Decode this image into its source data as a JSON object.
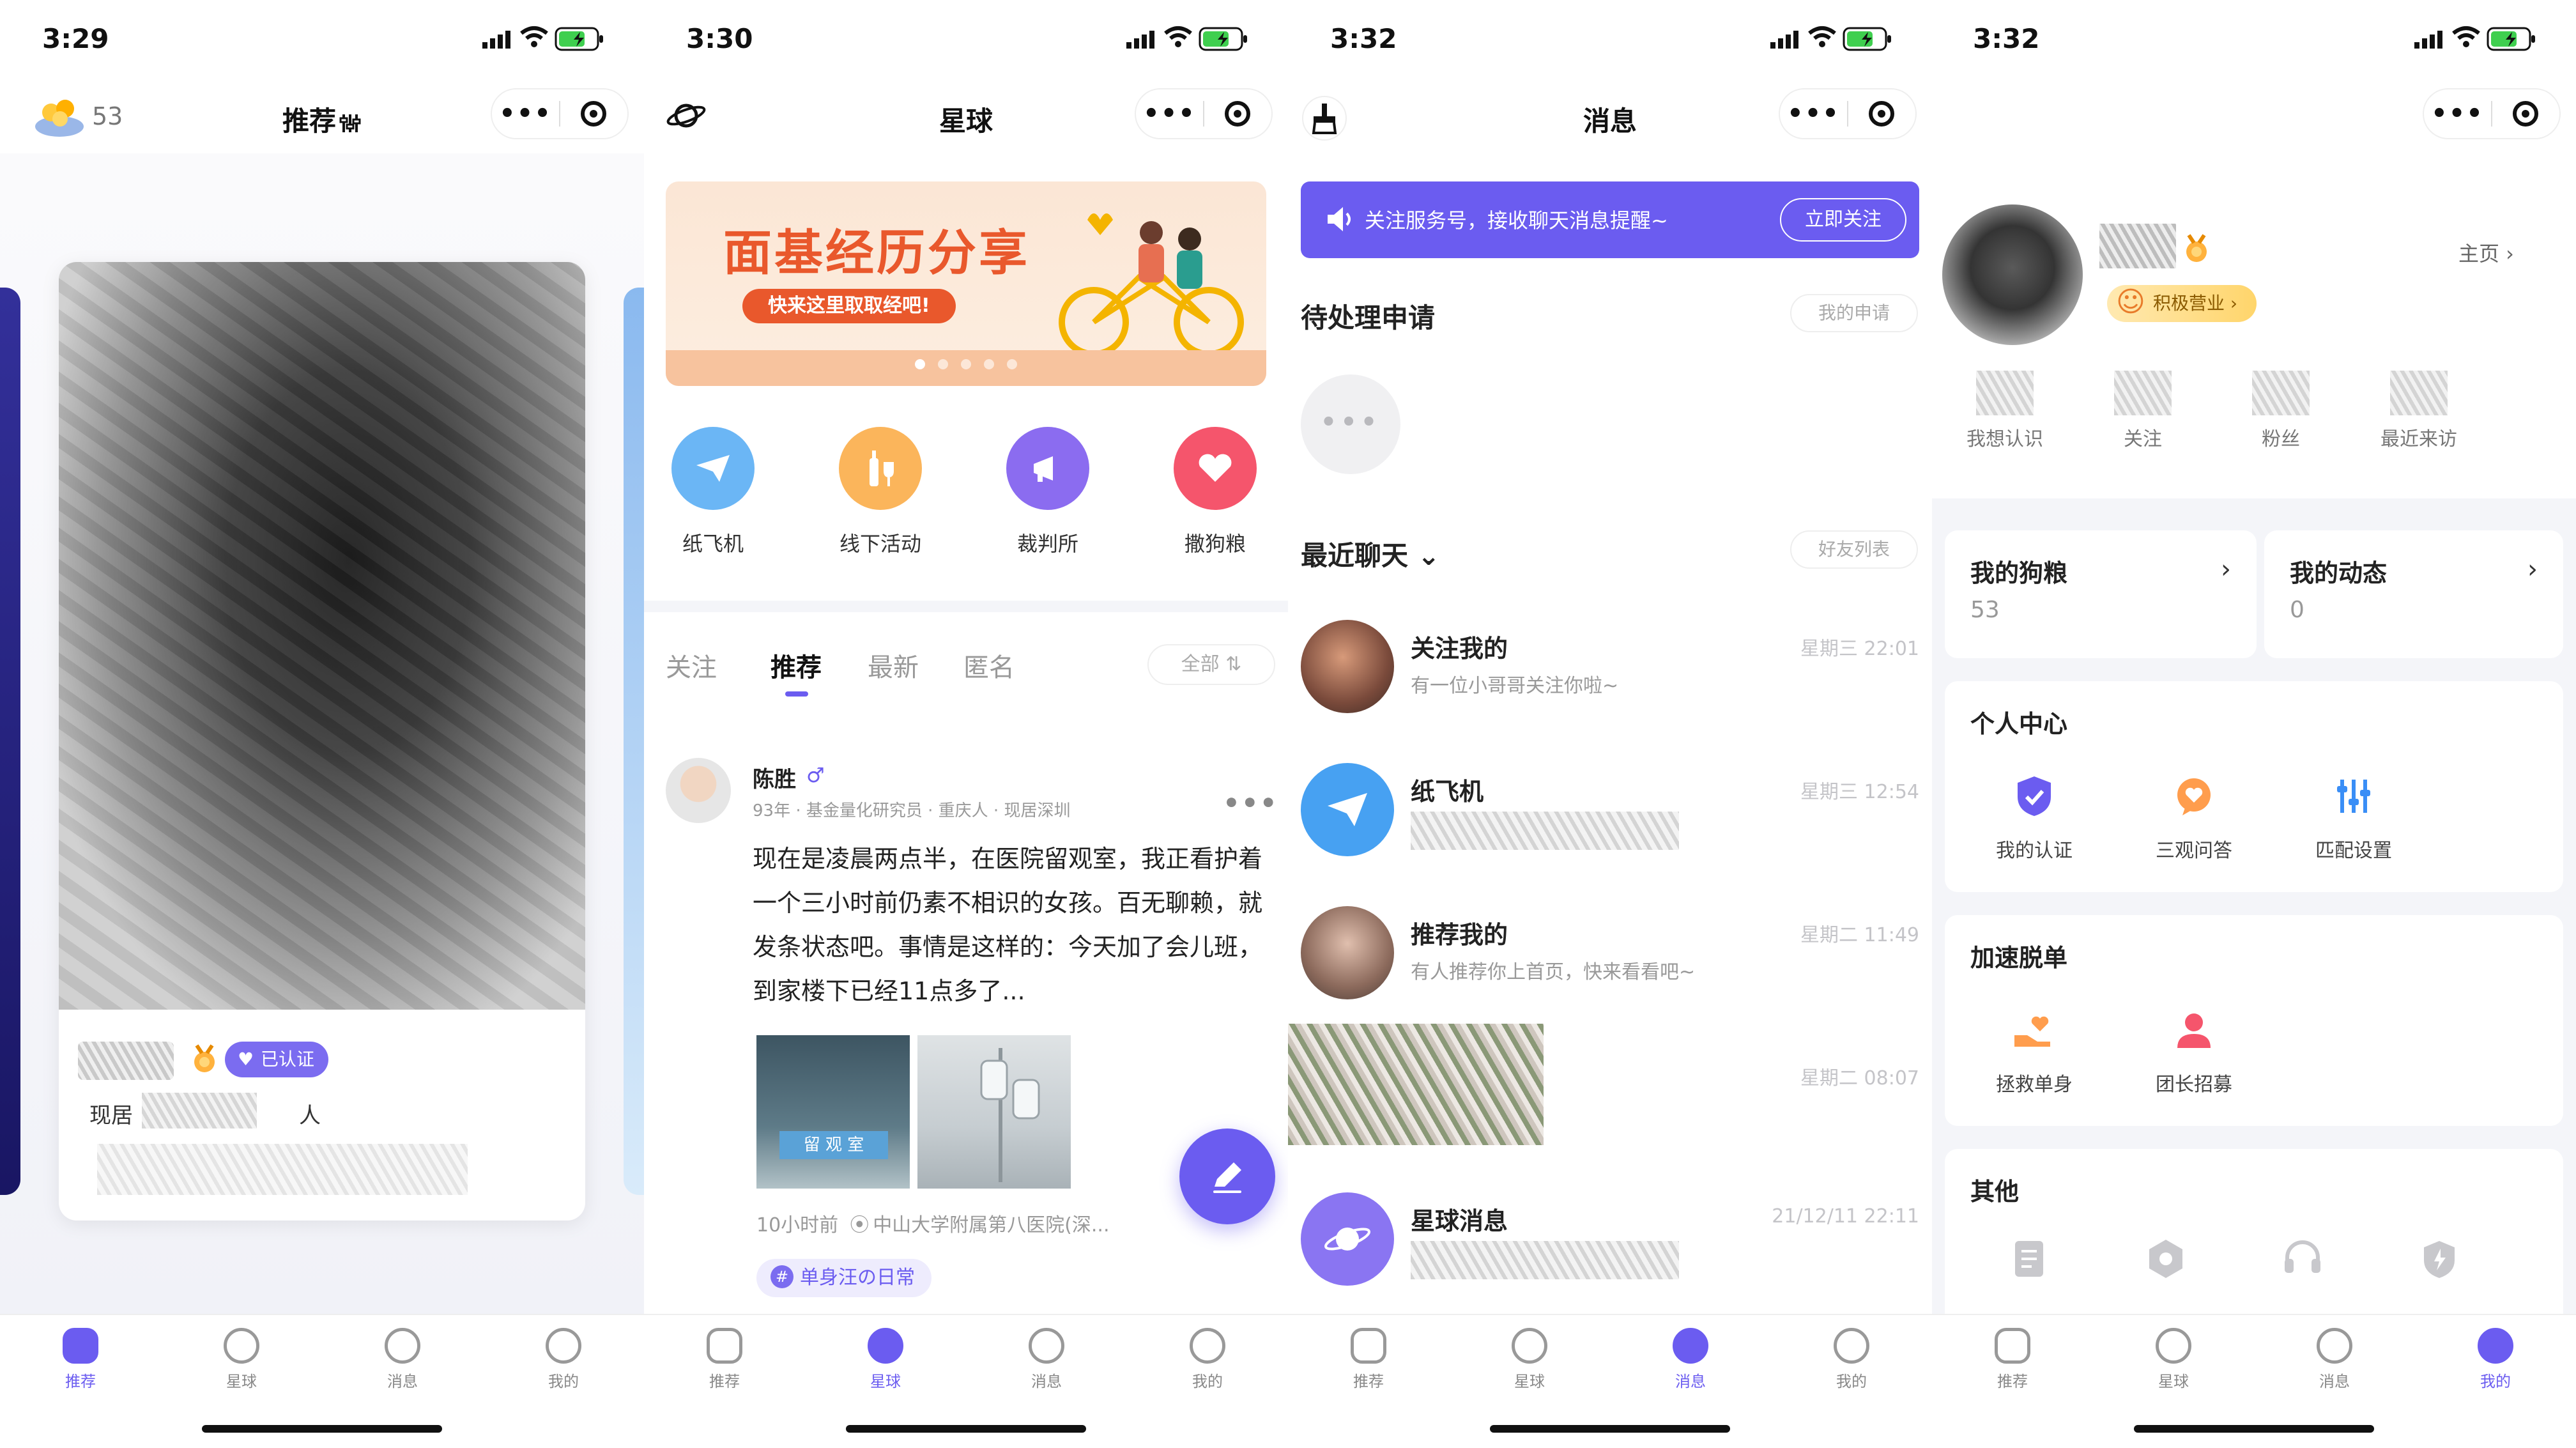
{
  "colors": {
    "accent": "#6b5cf0",
    "orange": "#e9582c",
    "bg": "#f4f5f9"
  },
  "screens": {
    "recommend": {
      "status_time": "3:29",
      "coin_count": "53",
      "title": "推荐",
      "card": {
        "verified": "已认证",
        "location": "现居",
        "location_suffix": "人"
      },
      "tabs": [
        "推荐",
        "星球",
        "消息",
        "我的"
      ]
    },
    "planet": {
      "status_time": "3:30",
      "title": "星球",
      "banner": {
        "title": "面基经历分享",
        "subtitle": "快来这里取取经吧!"
      },
      "quick": [
        "纸飞机",
        "线下活动",
        "裁判所",
        "撒狗粮"
      ],
      "feed_tabs": [
        "关注",
        "推荐",
        "最新",
        "匿名"
      ],
      "filter": "全部 ⇅",
      "post": {
        "author": "陈胜",
        "gender": "♂",
        "meta": "93年 · 基金量化研究员 · 重庆人 · 现居深圳",
        "body": "现在是凌晨两点半，在医院留观室，我正看护着一个三小时前仍素不相识的女孩。百无聊赖，就发条状态吧。事情是这样的：今天加了会儿班，到家楼下已经11点多了...",
        "image1_text": "留 观 室",
        "time": "10小时前",
        "place": "中山大学附属第八医院(深...",
        "topic": "单身汪の日常"
      },
      "tabs": [
        "推荐",
        "星球",
        "消息",
        "我的"
      ]
    },
    "messages": {
      "status_time": "3:32",
      "title": "消息",
      "notice": {
        "text": "关注服务号，接收聊天消息提醒~",
        "button": "立即关注"
      },
      "pending": {
        "title": "待处理申请",
        "button": "我的申请"
      },
      "recent": {
        "title": "最近聊天 ⌄",
        "button": "好友列表"
      },
      "chats": [
        {
          "name": "关注我的",
          "preview": "有一位小哥哥关注你啦~",
          "time": "星期三 22:01"
        },
        {
          "name": "纸飞机",
          "preview": "",
          "time": "星期三 12:54"
        },
        {
          "name": "推荐我的",
          "preview": "有人推荐你上首页，快来看看吧~",
          "time": "星期二 11:49"
        },
        {
          "name": "",
          "preview": "",
          "time": "星期二 08:07"
        },
        {
          "name": "星球消息",
          "preview": "",
          "time": "21/12/11 22:11"
        }
      ],
      "tabs": [
        "推荐",
        "星球",
        "消息",
        "我的"
      ]
    },
    "mine": {
      "status_time": "3:32",
      "badge": "积极营业 ›",
      "home": "主页 ›",
      "stats": [
        "我想认识",
        "关注",
        "粉丝",
        "最近来访"
      ],
      "cards": [
        {
          "title": "我的狗粮",
          "value": "53"
        },
        {
          "title": "我的动态",
          "value": "0"
        }
      ],
      "personal": {
        "title": "个人中心",
        "items": [
          "我的认证",
          "三观问答",
          "匹配设置"
        ]
      },
      "speed": {
        "title": "加速脱单",
        "items": [
          "拯救单身",
          "团长招募"
        ]
      },
      "other": {
        "title": "其他"
      },
      "tabs": [
        "推荐",
        "星球",
        "消息",
        "我的"
      ]
    }
  }
}
